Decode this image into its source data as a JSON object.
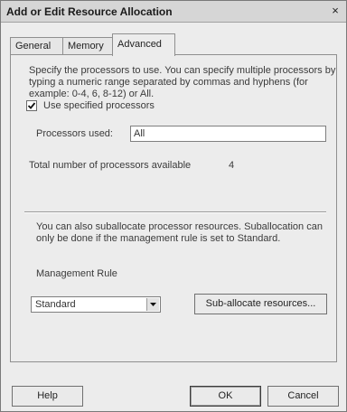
{
  "window": {
    "title": "Add or Edit Resource Allocation",
    "close_glyph": "×"
  },
  "tabs": [
    {
      "label": "General",
      "active": false
    },
    {
      "label": "Memory",
      "active": false
    },
    {
      "label": "Advanced",
      "active": true
    }
  ],
  "advanced": {
    "intro_text": "Specify the processors to use. You can specify multiple processors by typing a numeric range separated by commas and hyphens (for example: 0-4, 6, 8-12) or All.",
    "use_specified": {
      "label": "Use specified processors",
      "checked": true
    },
    "processors_used": {
      "label": "Processors used:",
      "value": "All"
    },
    "total_processors": {
      "label": "Total number of processors available",
      "value": "4"
    },
    "suballocate_text": "You can also suballocate processor resources. Suballocation can only be done if the management rule is set to Standard.",
    "management_rule": {
      "label": "Management Rule",
      "selected": "Standard"
    },
    "suballocate_button": "Sub-allocate resources..."
  },
  "footer": {
    "help": "Help",
    "ok": "OK",
    "cancel": "Cancel"
  }
}
